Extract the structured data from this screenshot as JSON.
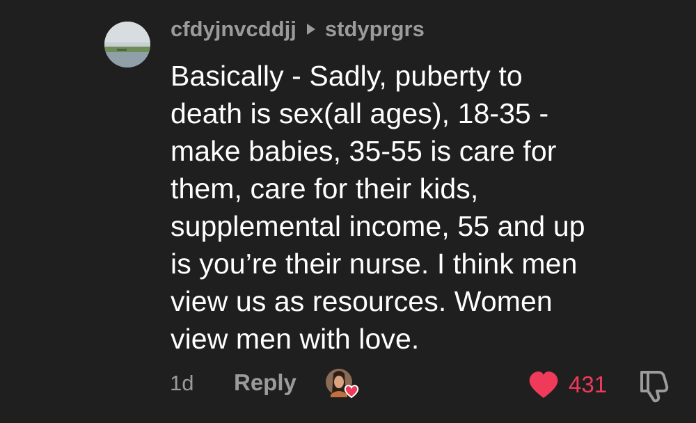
{
  "comment": {
    "author": "cfdyjnvcddjj",
    "reply_to": "stdyprgrs",
    "text": "Basically - Sadly, puberty to\ndeath is sex(all ages), 18-35 -\nmake babies, 35-55 is care for\nthem, care for their kids,\nsupplemental income, 55 and up\nis you’re their nurse. I think men\nview us as resources. Women\nview men with love.",
    "time": "1d",
    "reply_label": "Reply",
    "like_count": "431",
    "liked": true
  },
  "colors": {
    "background": "#1f1f1f",
    "muted_text": "#9b9b9b",
    "like_red": "#f03a5a"
  },
  "icons": {
    "reply_arrow": "triangle-right-icon",
    "heart": "heart-icon",
    "dislike": "thumbs-down-icon"
  }
}
